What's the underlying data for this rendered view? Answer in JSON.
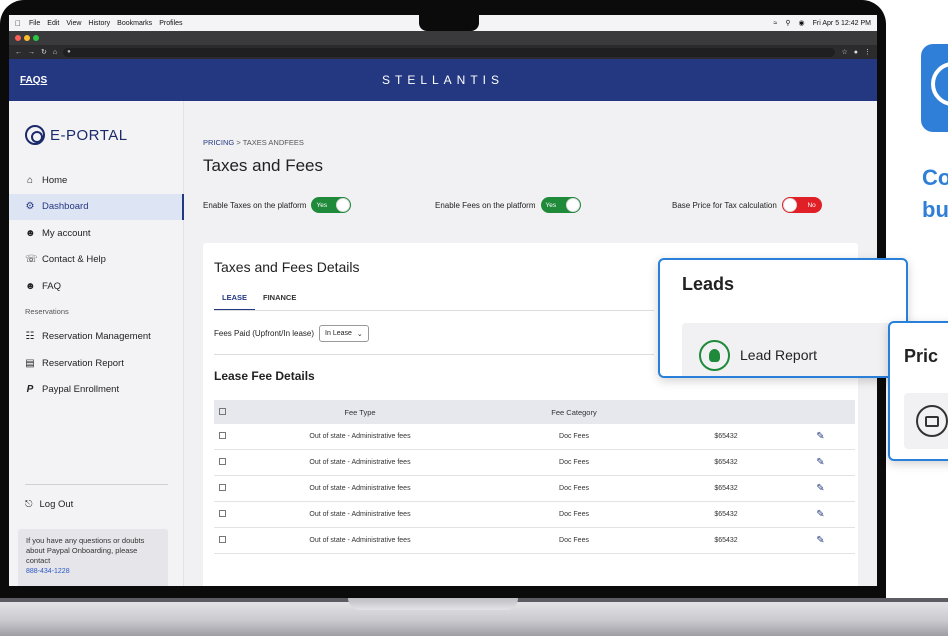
{
  "menubar": {
    "items": [
      "File",
      "Edit",
      "View",
      "History",
      "Bookmarks",
      "Profiles"
    ],
    "clock": "Fri Apr 5 12:42 PM"
  },
  "topnav": {
    "faqs": "FAQS",
    "brand": "STELLANTIS"
  },
  "sidebar": {
    "logo": "E-PORTAL",
    "items": [
      {
        "label": "Home",
        "icon": "home-icon"
      },
      {
        "label": "Dashboard",
        "icon": "gear-icon"
      },
      {
        "label": "My account",
        "icon": "user-icon"
      },
      {
        "label": "Contact & Help",
        "icon": "headset-icon"
      },
      {
        "label": "FAQ",
        "icon": "user-icon"
      }
    ],
    "section": "Reservations",
    "reservation_items": [
      {
        "label": "Reservation Management",
        "icon": "person-laptop-icon"
      },
      {
        "label": "Reservation Report",
        "icon": "report-icon"
      },
      {
        "label": "Paypal Enrollment",
        "icon": "paypal-icon"
      }
    ],
    "logout": "Log Out",
    "help_text": "If you have any questions or doubts about Paypal Onboarding, please contact",
    "help_phone": "888-434-1228"
  },
  "breadcrumb": {
    "parent": "PRICING",
    "sep": ">",
    "current": "TAXES ANDFEES"
  },
  "page_title": "Taxes and Fees",
  "toggles": [
    {
      "label": "Enable Taxes on the platform",
      "state": "Yes"
    },
    {
      "label": "Enable Fees on the platform",
      "state": "Yes"
    },
    {
      "label": "Base Price for Tax calculation",
      "state": "No"
    }
  ],
  "details": {
    "title": "Taxes and Fees Details",
    "tabs": [
      "LEASE",
      "FINANCE"
    ],
    "fees_paid_label": "Fees Paid (Upfront/In lease)",
    "fees_paid_value": "In Lease",
    "lease_title": "Lease Fee Details",
    "columns": [
      "Fee Type",
      "Fee Category"
    ],
    "rows": [
      {
        "type": "Out of state - Administrative fees",
        "category": "Doc Fees",
        "amount": "$65432"
      },
      {
        "type": "Out of state - Administrative fees",
        "category": "Doc Fees",
        "amount": "$65432"
      },
      {
        "type": "Out of state - Administrative fees",
        "category": "Doc Fees",
        "amount": "$65432"
      },
      {
        "type": "Out of state - Administrative fees",
        "category": "Doc Fees",
        "amount": "$65432"
      },
      {
        "type": "Out of state - Administrative fees",
        "category": "Doc Fees",
        "amount": "$65432"
      }
    ]
  },
  "leads_card": {
    "title": "Leads",
    "item": "Lead Report"
  },
  "price_card": {
    "title": "Pric"
  },
  "side_text": {
    "line1": "Co",
    "line2": "bu"
  },
  "colors": {
    "brand_navy": "#243882",
    "accent_blue": "#2f7fd8",
    "on_green": "#1f8a3a",
    "off_red": "#e01f26"
  }
}
